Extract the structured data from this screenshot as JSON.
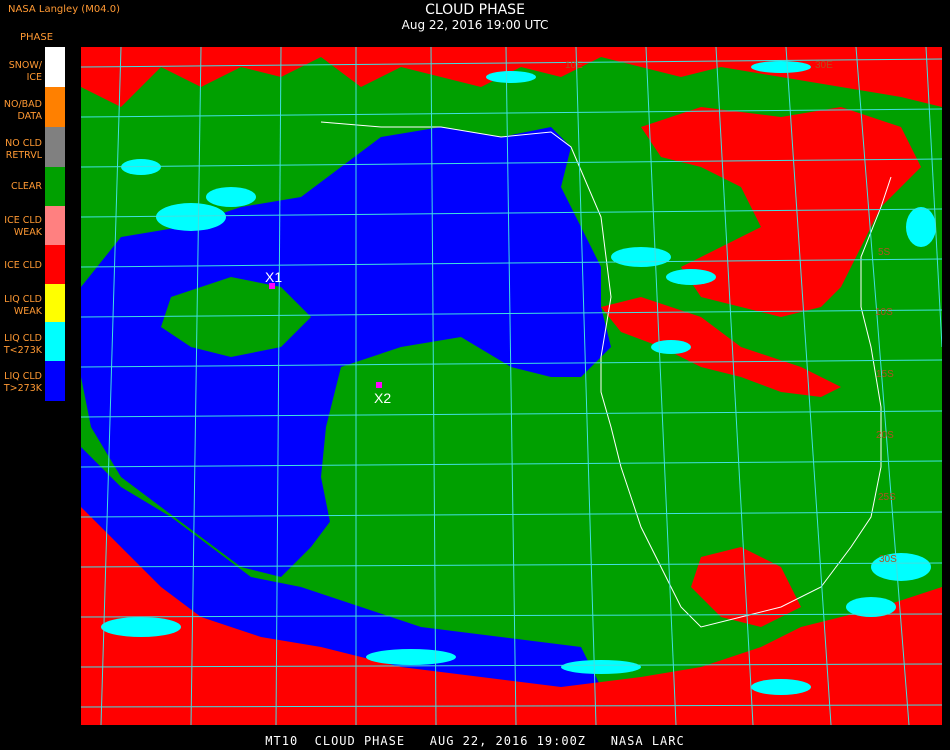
{
  "header": {
    "title": "CLOUD PHASE",
    "subtitle": "Aug 22, 2016 19:00 UTC",
    "provider": "NASA Langley (M04.0)"
  },
  "legend": {
    "title": "PHASE",
    "items": [
      {
        "label": "SNOW/\nICE",
        "color": "#ffffff"
      },
      {
        "label": "NO/BAD\nDATA",
        "color": "#ff8000"
      },
      {
        "label": "NO CLD\nRETRVL",
        "color": "#808080"
      },
      {
        "label": "CLEAR",
        "color": "#00a000"
      },
      {
        "label": "ICE CLD\nWEAK",
        "color": "#ff8080"
      },
      {
        "label": "ICE CLD",
        "color": "#ff0000"
      },
      {
        "label": "LIQ CLD\nWEAK",
        "color": "#ffff00"
      },
      {
        "label": "LIQ CLD\nT<273K",
        "color": "#00ffff"
      },
      {
        "label": "LIQ CLD\nT>273K",
        "color": "#0000ff"
      }
    ]
  },
  "map": {
    "lon_labels": [
      "10E",
      "30E"
    ],
    "lat_labels": [
      "5S",
      "10S",
      "15S",
      "20S",
      "25S",
      "30S"
    ],
    "markers": [
      {
        "label": "X1",
        "color": "#ff00ff"
      },
      {
        "label": "X2",
        "color": "#ff00ff"
      }
    ],
    "grid_color": "#40e0e0",
    "label_color": "#b05020",
    "coastline_color": "#ffffff"
  },
  "footer": "MT10  CLOUD PHASE   AUG 22, 2016 19:00Z   NASA LARC"
}
